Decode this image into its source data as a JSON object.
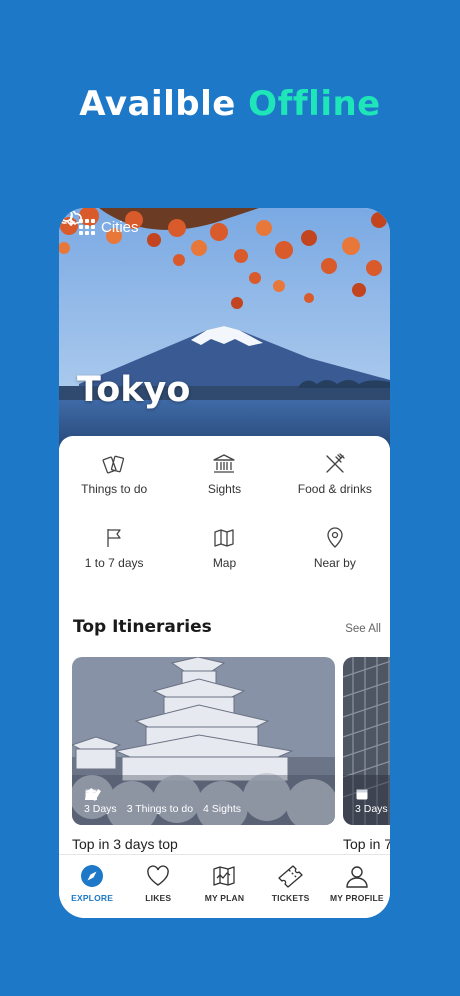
{
  "promo": {
    "headline_main": "Availble",
    "headline_accent": "Offline"
  },
  "colors": {
    "background": "#1e78c8",
    "accent": "#1fe6b8",
    "active_tab": "#1e78c8"
  },
  "header": {
    "cities_label": "Cities",
    "icons": [
      "grid-icon",
      "cloud-download-icon",
      "search-icon"
    ]
  },
  "hero": {
    "city_name": "Tokyo"
  },
  "categories": [
    {
      "label": "Things to do",
      "icon": "tickets-icon"
    },
    {
      "label": "Sights",
      "icon": "landmark-icon"
    },
    {
      "label": "Food & drinks",
      "icon": "fork-knife-icon"
    },
    {
      "label": "1 to 7 days",
      "icon": "flag-icon"
    },
    {
      "label": "Map",
      "icon": "map-icon"
    },
    {
      "label": "Near by",
      "icon": "location-pin-icon"
    }
  ],
  "itineraries": {
    "title": "Top Itineraries",
    "see_all": "See All",
    "cards": [
      {
        "caption": "Top in 3 days top",
        "stats": [
          {
            "label": "3 Days",
            "icon": "calendar-icon"
          },
          {
            "label": "3 Things to do",
            "icon": "tickets-icon"
          },
          {
            "label": "4 Sights",
            "icon": "landmark-icon"
          }
        ]
      },
      {
        "caption": "Top in 7",
        "stats": [
          {
            "label": "3 Days",
            "icon": "calendar-icon"
          }
        ]
      }
    ]
  },
  "tabs": [
    {
      "label": "EXPLORE",
      "icon": "compass-icon",
      "active": true
    },
    {
      "label": "LIKES",
      "icon": "heart-icon",
      "active": false
    },
    {
      "label": "MY PLAN",
      "icon": "map-plan-icon",
      "active": false
    },
    {
      "label": "TICKETS",
      "icon": "ticket-icon",
      "active": false
    },
    {
      "label": "MY PROFILE",
      "icon": "user-icon",
      "active": false
    }
  ]
}
